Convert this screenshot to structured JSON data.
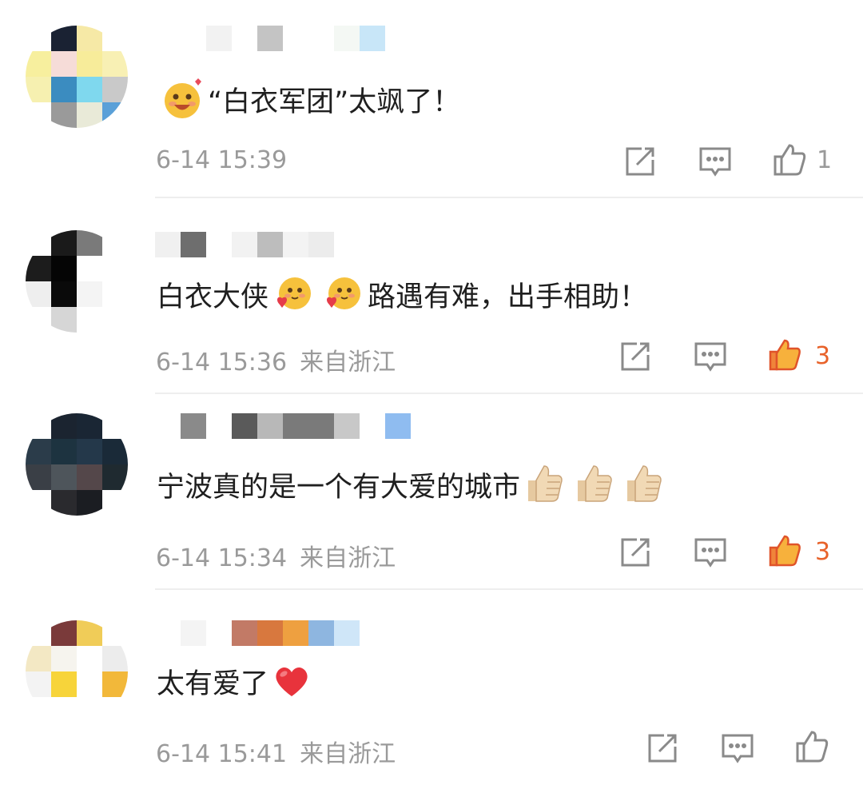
{
  "comments": [
    {
      "text": "“白衣军团”太飒了！",
      "time": "6-14 15:39",
      "location": "",
      "likes": "1",
      "liked": false,
      "emojis": [
        "blushing-grin-emoji"
      ]
    },
    {
      "text_a": "白衣大侠",
      "text_b": "路遇有难，出手相助！",
      "time": "6-14 15:36",
      "location": "来自浙江",
      "likes": "3",
      "liked": true,
      "emojis": [
        "heart-hug-emoji",
        "heart-hug-emoji"
      ]
    },
    {
      "text": "宁波真的是一个有大爱的城市",
      "time": "6-14 15:34",
      "location": "来自浙江",
      "likes": "3",
      "liked": true,
      "emojis": [
        "thumbs-up-emoji",
        "thumbs-up-emoji",
        "thumbs-up-emoji"
      ]
    },
    {
      "text": "太有爱了",
      "time": "6-14 15:41",
      "location": "来自浙江",
      "likes": "",
      "liked": false,
      "emojis": [
        "red-heart-emoji"
      ]
    }
  ],
  "icons": {
    "repost": "repost-icon",
    "reply": "reply-icon",
    "like": "thumbs-up-icon"
  },
  "colors": {
    "text": "#1f1f1f",
    "meta": "#9a9a9a",
    "liked": "#e8622a",
    "divider": "#eeeeee"
  }
}
